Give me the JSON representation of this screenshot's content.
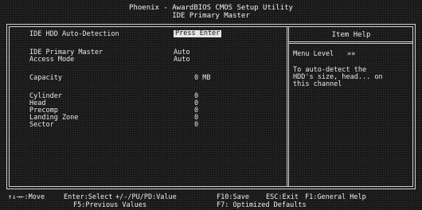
{
  "header": {
    "title_line1": "Phoenix - AwardBIOS CMOS Setup Utility",
    "title_line2": "IDE Primary Master"
  },
  "settings": {
    "auto_detect_label": "IDE HDD Auto-Detection",
    "auto_detect_value": "Press Enter",
    "primary_master_label": "IDE Primary Master",
    "primary_master_value": "Auto",
    "access_mode_label": "Access Mode",
    "access_mode_value": "Auto",
    "capacity_label": "Capacity",
    "capacity_value": "0 MB",
    "cylinder_label": "Cylinder",
    "cylinder_value": "0",
    "head_label": "Head",
    "head_value": "0",
    "precomp_label": "Precomp",
    "precomp_value": "0",
    "landing_zone_label": "Landing Zone",
    "landing_zone_value": "0",
    "sector_label": "Sector",
    "sector_value": "0"
  },
  "help": {
    "title": "Item Help",
    "menu_level_label": "Menu Level",
    "menu_level_value": "»»",
    "line1": "To auto-detect the",
    "line2": "HDD's size, head... on",
    "line3": "this channel"
  },
  "footer": {
    "move": "↑↓→←:Move",
    "select": "Enter:Select",
    "value": "+/-/PU/PD:Value",
    "save": "F10:Save",
    "exit": "ESC:Exit",
    "general_help": "F1:General Help",
    "previous_values": "F5:Previous Values",
    "optimized_defaults": "F7: Optimized Defaults"
  }
}
